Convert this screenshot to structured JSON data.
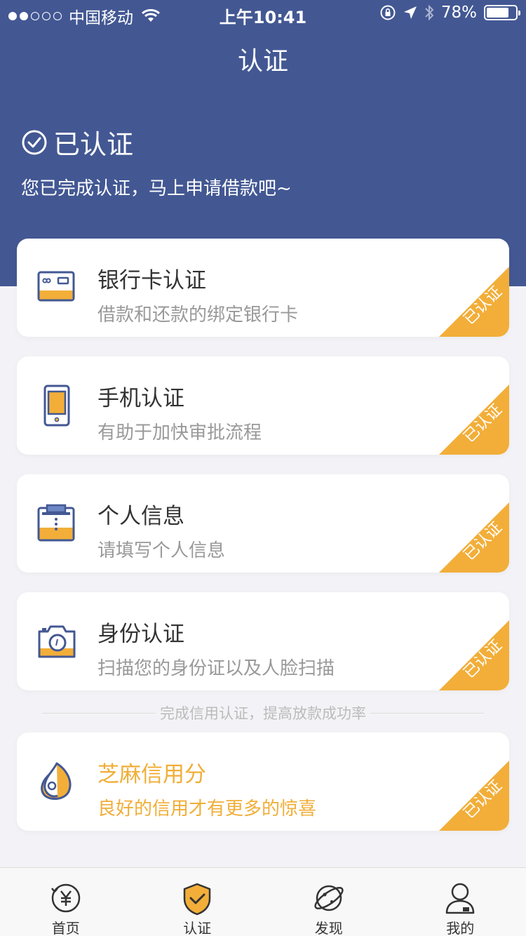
{
  "status_bar": {
    "carrier": "中国移动",
    "time": "上午10:41",
    "battery_percent": "78%",
    "battery_level": 0.78
  },
  "nav": {
    "title": "认证"
  },
  "header": {
    "status_title": "已认证",
    "status_subtitle": "您已完成认证，马上申请借款吧~"
  },
  "cards": [
    {
      "title": "银行卡认证",
      "subtitle": "借款和还款的绑定银行卡",
      "badge": "已认证",
      "icon": "bank-card-icon"
    },
    {
      "title": "手机认证",
      "subtitle": "有助于加快审批流程",
      "badge": "已认证",
      "icon": "phone-icon"
    },
    {
      "title": "个人信息",
      "subtitle": "请填写个人信息",
      "badge": "已认证",
      "icon": "personal-info-icon"
    },
    {
      "title": "身份认证",
      "subtitle": "扫描您的身份证以及人脸扫描",
      "badge": "已认证",
      "icon": "camera-icon"
    }
  ],
  "divider_text": "完成信用认证，提高放款成功率",
  "sesame_card": {
    "title": "芝麻信用分",
    "subtitle": "良好的信用才有更多的惊喜",
    "badge": "已认证",
    "icon": "sesame-icon"
  },
  "tabs": [
    {
      "label": "首页",
      "icon": "home-yen-icon"
    },
    {
      "label": "认证",
      "icon": "shield-check-icon"
    },
    {
      "label": "发现",
      "icon": "planet-icon"
    },
    {
      "label": "我的",
      "icon": "profile-icon"
    }
  ],
  "colors": {
    "header_bg": "#435893",
    "accent_orange": "#f2ae39",
    "page_bg": "#f3f3f7"
  }
}
